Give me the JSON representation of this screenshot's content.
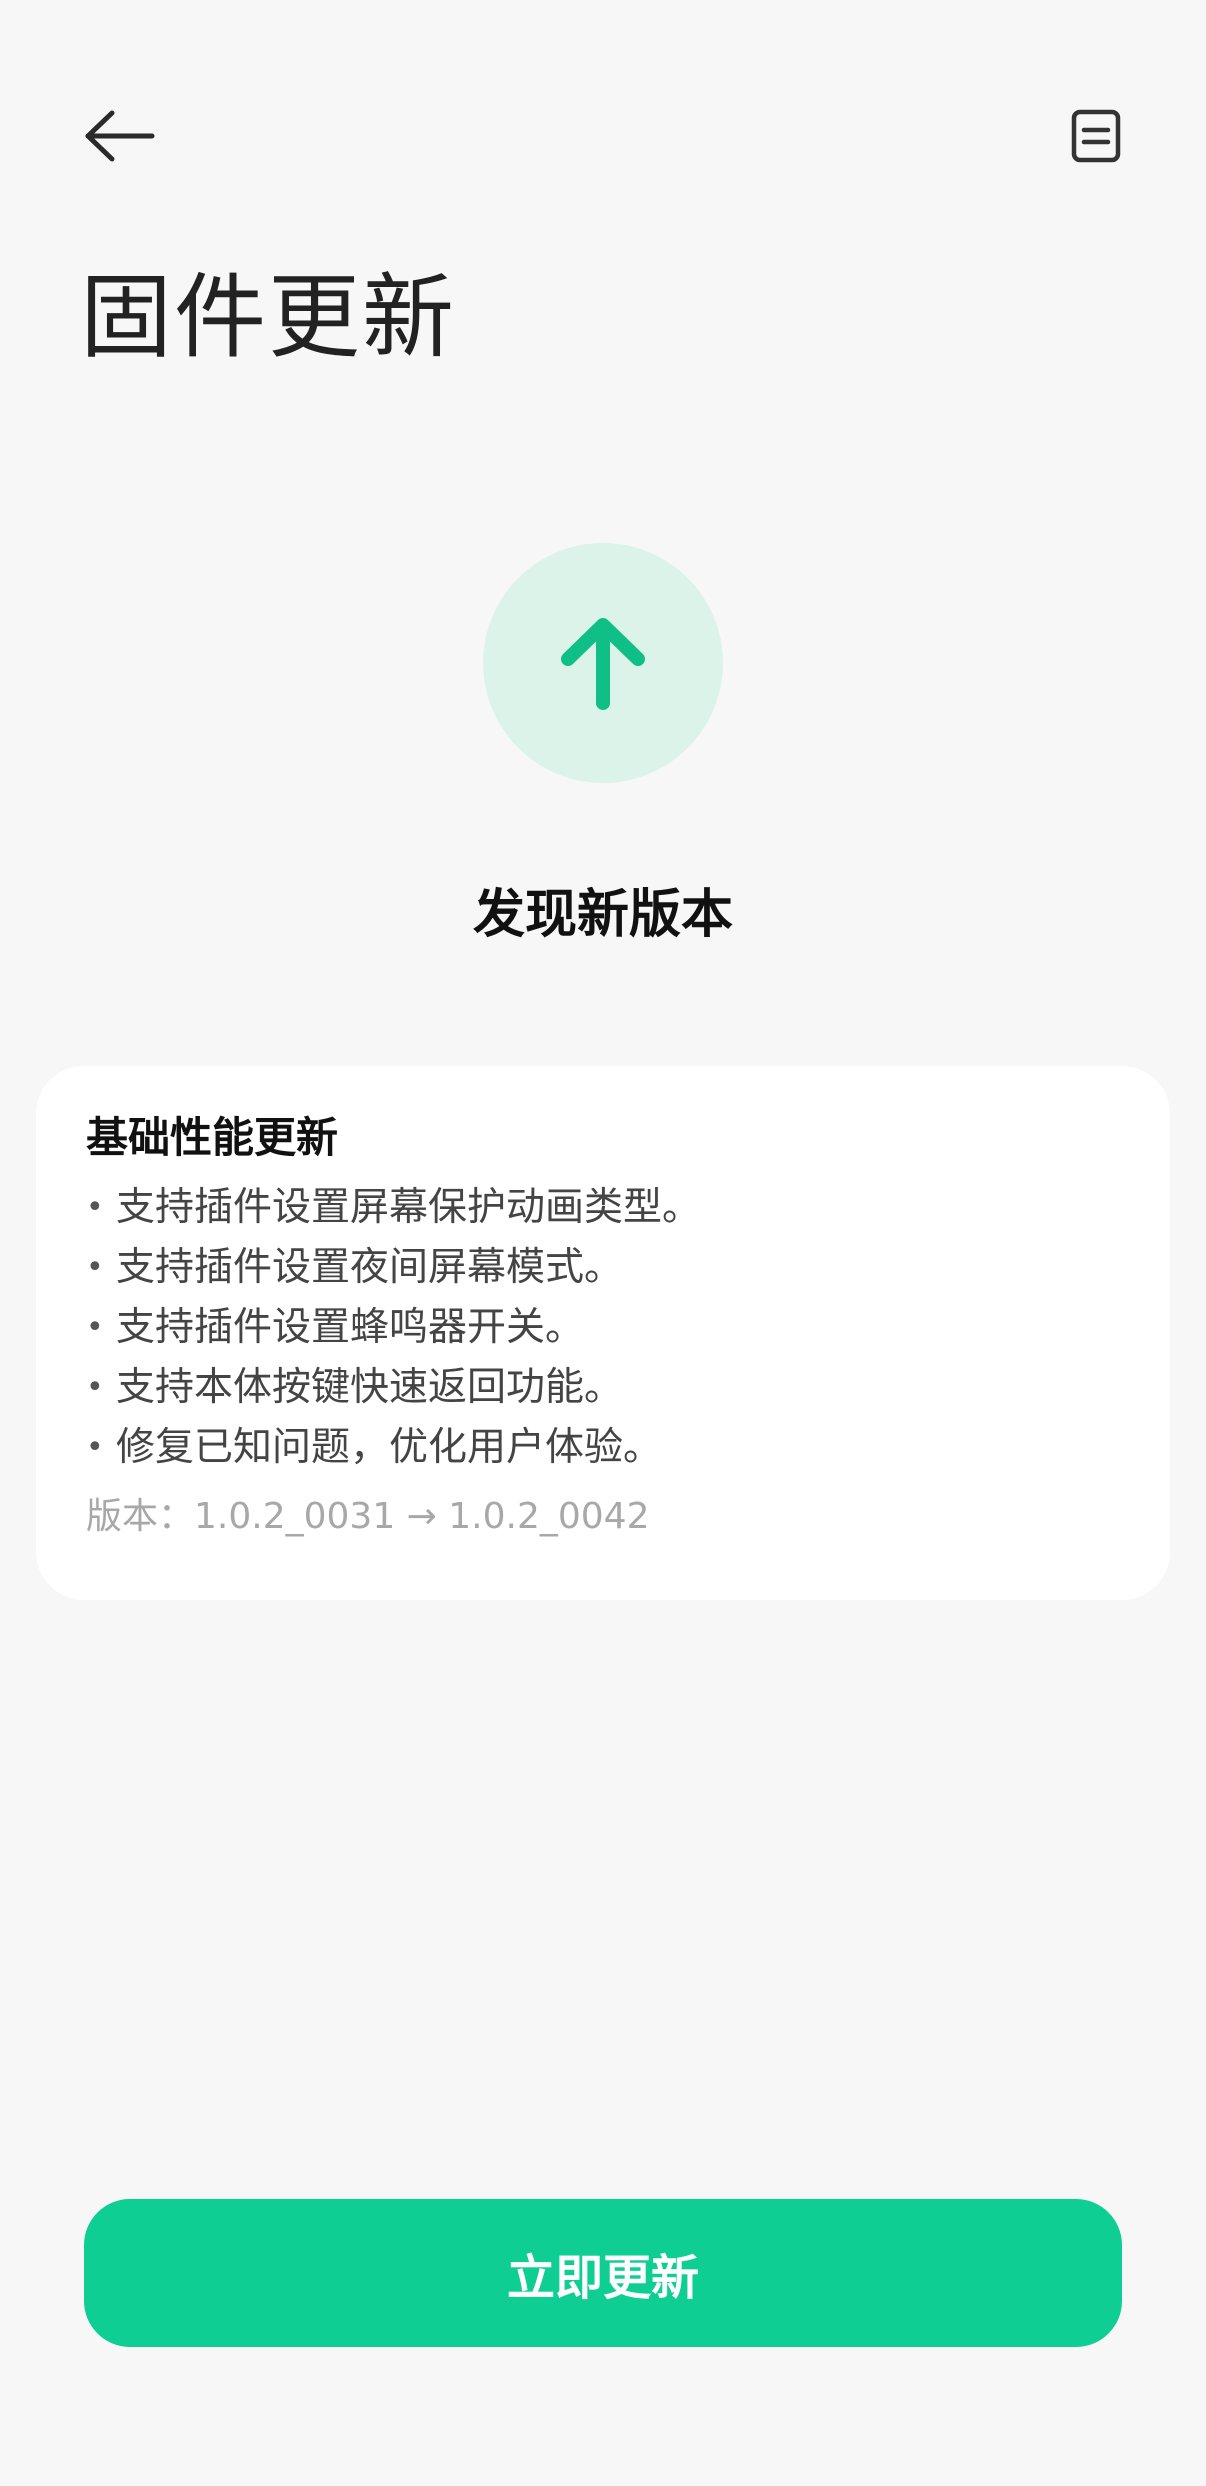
{
  "header": {
    "title": "固件更新",
    "back_icon": "arrow-left-icon",
    "notes_icon": "document-icon"
  },
  "status": {
    "icon": "arrow-up-icon",
    "title": "发现新版本",
    "accent_color": "#0fce94",
    "badge_color": "#dcf3ea"
  },
  "release_notes": {
    "title": "基础性能更新",
    "items": [
      "支持插件设置屏幕保护动画类型。",
      "支持插件设置夜间屏幕模式。",
      "支持插件设置蜂鸣器开关。",
      "支持本体按键快速返回功能。",
      "修复已知问题，优化用户体验。"
    ],
    "bullet": "•",
    "version": "版本：1.0.2_0031 → 1.0.2_0042"
  },
  "actions": {
    "update_label": "立即更新"
  }
}
